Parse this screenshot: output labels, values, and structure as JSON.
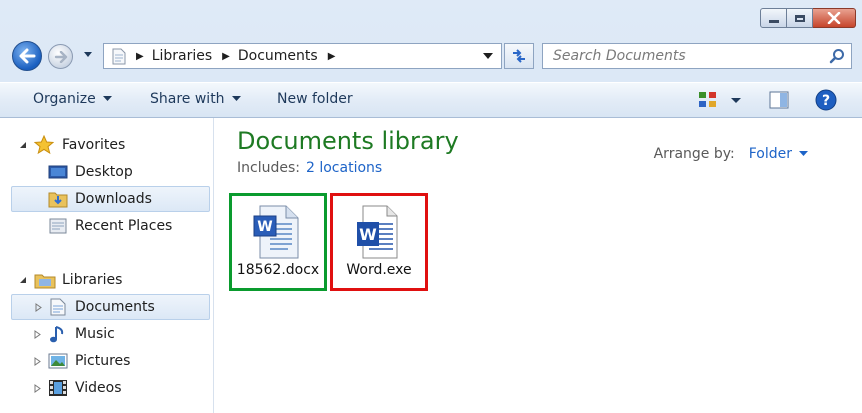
{
  "address": {
    "crumbs": [
      "Libraries",
      "Documents"
    ]
  },
  "search": {
    "placeholder": "Search Documents"
  },
  "toolbar": {
    "organize": "Organize",
    "share_with": "Share with",
    "new_folder": "New folder"
  },
  "nav_pane": {
    "favorites": {
      "label": "Favorites",
      "items": [
        "Desktop",
        "Downloads",
        "Recent Places"
      ]
    },
    "libraries": {
      "label": "Libraries",
      "items": [
        "Documents",
        "Music",
        "Pictures",
        "Videos"
      ]
    }
  },
  "main": {
    "title": "Documents library",
    "includes_label": "Includes:",
    "includes_link": "2 locations",
    "arrange_label": "Arrange by:",
    "arrange_value": "Folder",
    "files": [
      {
        "name": "18562.docx",
        "icon": "word-document-icon",
        "highlight": "#0a9b2e"
      },
      {
        "name": "Word.exe",
        "icon": "word-application-icon",
        "highlight": "#e01010"
      }
    ]
  },
  "colors": {
    "title_green": "#1e7a23",
    "link_blue": "#1e64c8"
  }
}
